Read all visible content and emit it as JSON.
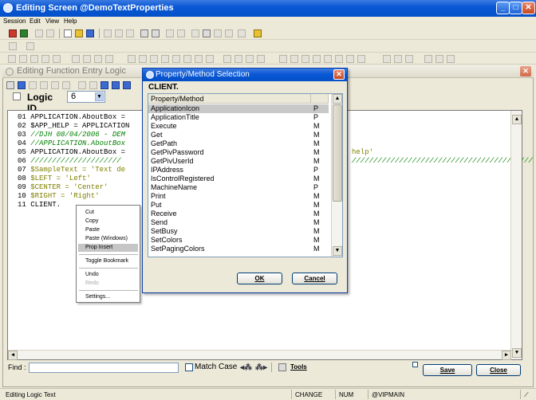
{
  "window": {
    "title": "Editing Screen @DemoTextProperties"
  },
  "menubar": {
    "items": [
      "Session",
      "Edit",
      "View",
      "Help"
    ]
  },
  "inner_window": {
    "title": "Editing Function Entry Logic"
  },
  "logic": {
    "label": "Logic ID",
    "value": "6"
  },
  "editor": {
    "lines": [
      {
        "num": "01",
        "code": "APPLICATION.AboutBox ="
      },
      {
        "num": "02",
        "code": "$APP_HELP = APPLICATION"
      },
      {
        "num": "03",
        "code": "//DJH 08/04/2006 - DEM"
      },
      {
        "num": "04",
        "code": "//APPLICATION.AboutBox"
      },
      {
        "num": "05",
        "code": "APPLICATION.AboutBox ="
      },
      {
        "num": "06",
        "code": "/////////////////////"
      },
      {
        "num": "07",
        "code": "$SampleText = 'Text de"
      },
      {
        "num": "08",
        "code": "$LEFT = 'Left'"
      },
      {
        "num": "09",
        "code": "$CENTER = 'Center'"
      },
      {
        "num": "10",
        "code": "$RIGHT = 'Right'"
      },
      {
        "num": "11",
        "code": "CLIENT."
      }
    ],
    "line05_tail": "help'",
    "line06_tail": "//////////////////////////////////////////"
  },
  "context_menu": {
    "items": [
      "Cut",
      "Copy",
      "Paste",
      "Paste (Windows)",
      "Prop Insert",
      "Toggle Bookmark",
      "Undo",
      "Redo",
      "Settings..."
    ]
  },
  "dialog": {
    "title": "Property/Method Selection",
    "object": "CLIENT.",
    "column_header": "Property/Method",
    "rows": [
      {
        "name": "ApplicationIcon",
        "type": "P"
      },
      {
        "name": "ApplicationTitle",
        "type": "P"
      },
      {
        "name": "Execute",
        "type": "M"
      },
      {
        "name": "Get",
        "type": "M"
      },
      {
        "name": "GetPath",
        "type": "M"
      },
      {
        "name": "GetPivPassword",
        "type": "M"
      },
      {
        "name": "GetPivUserId",
        "type": "M"
      },
      {
        "name": "IPAddress",
        "type": "P"
      },
      {
        "name": "IsControlRegistered",
        "type": "M"
      },
      {
        "name": "MachineName",
        "type": "P"
      },
      {
        "name": "Print",
        "type": "M"
      },
      {
        "name": "Put",
        "type": "M"
      },
      {
        "name": "Receive",
        "type": "M"
      },
      {
        "name": "Send",
        "type": "M"
      },
      {
        "name": "SetBusy",
        "type": "M"
      },
      {
        "name": "SetColors",
        "type": "M"
      },
      {
        "name": "SetPagingColors",
        "type": "M"
      }
    ],
    "ok_label": "OK",
    "cancel_label": "Cancel"
  },
  "findbar": {
    "find_label": "Find :",
    "match_case_label": "Match Case",
    "tools_label": "Tools",
    "save_label": "Save",
    "close_label": "Close"
  },
  "statusbar": {
    "message": "Editing Logic Text",
    "mode": "CHANGE",
    "num": "NUM",
    "user": "@VIPMAIN"
  }
}
